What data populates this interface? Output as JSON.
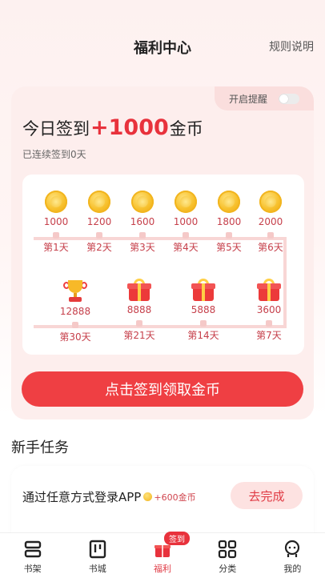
{
  "header": {
    "title": "福利中心",
    "rules_link": "规则说明"
  },
  "checkin": {
    "remind_label": "开启提醒",
    "remind_enabled": false,
    "headline_prefix": "今日签到",
    "headline_amount": "+1000",
    "headline_suffix": "金币",
    "streak_text": "已连续签到0天",
    "row1": [
      {
        "value": "1000",
        "day": "第1天",
        "icon": "coin-icon"
      },
      {
        "value": "1200",
        "day": "第2天",
        "icon": "coin-icon"
      },
      {
        "value": "1600",
        "day": "第3天",
        "icon": "coin-icon"
      },
      {
        "value": "1000",
        "day": "第4天",
        "icon": "coin-icon"
      },
      {
        "value": "1800",
        "day": "第5天",
        "icon": "coin-icon"
      },
      {
        "value": "2000",
        "day": "第6天",
        "icon": "coin-icon"
      }
    ],
    "row2": [
      {
        "value": "12888",
        "day": "第30天",
        "icon": "trophy-icon"
      },
      {
        "value": "8888",
        "day": "第21天",
        "icon": "gift-icon"
      },
      {
        "value": "5888",
        "day": "第14天",
        "icon": "gift-icon"
      },
      {
        "value": "3600",
        "day": "第7天",
        "icon": "gift-icon"
      }
    ],
    "button_label": "点击签到领取金币"
  },
  "tasks": {
    "section_title": "新手任务",
    "items": [
      {
        "text": "通过任意方式登录APP",
        "reward": "+600金币",
        "button": "去完成"
      }
    ]
  },
  "nav": {
    "items": [
      {
        "label": "书架",
        "icon": "bookshelf-icon"
      },
      {
        "label": "书城",
        "icon": "bookstore-icon"
      },
      {
        "label": "福利",
        "icon": "gift-icon",
        "badge": "签到",
        "active": true
      },
      {
        "label": "分类",
        "icon": "category-grid-icon"
      },
      {
        "label": "我的",
        "icon": "profile-icon"
      }
    ]
  },
  "colors": {
    "accent": "#e8323c",
    "card_bg": "#fdeeed",
    "value_text": "#c6404b"
  }
}
